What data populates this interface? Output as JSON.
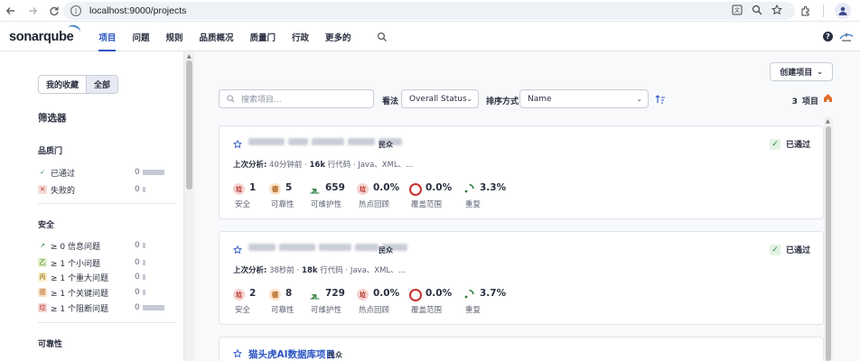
{
  "browser": {
    "url": "localhost:9000/projects"
  },
  "header": {
    "logo": "sonarqube",
    "menu": [
      "项目",
      "问题",
      "规则",
      "品质概况",
      "质量门",
      "行政",
      "更多的"
    ],
    "active_index": 0,
    "help": "?"
  },
  "sidebar": {
    "tabs": [
      "我的收藏",
      "全部"
    ],
    "selected_tab": "全部",
    "title": "筛选器",
    "quality_gate": {
      "heading": "品质门",
      "items": [
        {
          "icon": "check-icon",
          "label": "已通过",
          "count": "0"
        },
        {
          "icon": "cross-icon",
          "label": "失败的",
          "count": "0"
        }
      ]
    },
    "security": {
      "heading": "安全",
      "items": [
        {
          "icon": "info-arrow-icon",
          "label": "≥ 0 信息问题",
          "count": "0"
        },
        {
          "icon": "minor-icon",
          "label": "≥ 1 个小问题",
          "count": "0"
        },
        {
          "icon": "major-icon",
          "label": "≥ 1 个重大问题",
          "count": "0"
        },
        {
          "icon": "critical-icon",
          "label": "≥ 1 个关键问题",
          "count": "0"
        },
        {
          "icon": "blocker-icon",
          "label": "≥ 1 个阻断问题",
          "count": "0"
        }
      ]
    },
    "reliability": {
      "heading": "可靠性"
    }
  },
  "toolbar": {
    "create_label": "创建项目",
    "search_placeholder": "搜索项目...",
    "perspective_label": "看法",
    "perspective_value": "Overall Status",
    "sort_label": "排序方式",
    "sort_value": "Name",
    "count": "3",
    "count_unit": "项目"
  },
  "projects": [
    {
      "name": "",
      "visibility": "民众",
      "status": "已通过",
      "meta_prefix": "上次分析:",
      "analyzed": "40分钟前 · ",
      "lines": "16k",
      "lines_unit": " 行代码 · Java、XML、...",
      "metrics": [
        {
          "icon": "security-grade-icon",
          "grade": "垃",
          "value": "1",
          "label": "安全"
        },
        {
          "icon": "reliability-grade-icon",
          "grade": "德",
          "value": "5",
          "label": "可靠性"
        },
        {
          "icon": "maintainability-icon",
          "grade": "",
          "value": "659",
          "label": "可维护性"
        },
        {
          "icon": "hotspot-grade-icon",
          "grade": "垃",
          "value": "0.0%",
          "label": "热点回顾"
        },
        {
          "icon": "coverage-icon",
          "grade": "",
          "value": "0.0%",
          "label": "覆盖范围"
        },
        {
          "icon": "duplication-icon",
          "grade": "",
          "value": "3.3%",
          "label": "重复"
        }
      ]
    },
    {
      "name": "",
      "visibility": "民众",
      "status": "已通过",
      "meta_prefix": "上次分析:",
      "analyzed": "38秒前 · ",
      "lines": "18k",
      "lines_unit": " 行代码 · Java、XML、...",
      "metrics": [
        {
          "icon": "security-grade-icon",
          "grade": "垃",
          "value": "2",
          "label": "安全"
        },
        {
          "icon": "reliability-grade-icon",
          "grade": "德",
          "value": "8",
          "label": "可靠性"
        },
        {
          "icon": "maintainability-icon",
          "grade": "",
          "value": "729",
          "label": "可维护性"
        },
        {
          "icon": "hotspot-grade-icon",
          "grade": "垃",
          "value": "0.0%",
          "label": "热点回顾"
        },
        {
          "icon": "coverage-icon",
          "grade": "",
          "value": "0.0%",
          "label": "覆盖范围"
        },
        {
          "icon": "duplication-icon",
          "grade": "",
          "value": "3.7%",
          "label": "重复"
        }
      ]
    },
    {
      "name": "猫头虎AI数据库项目",
      "visibility": "民众"
    }
  ],
  "colors": {
    "accent": "#2b54c4",
    "grade_e": "#f4d3d0",
    "grade_d": "#fbe2c8",
    "passed": "#2c7e3d"
  }
}
